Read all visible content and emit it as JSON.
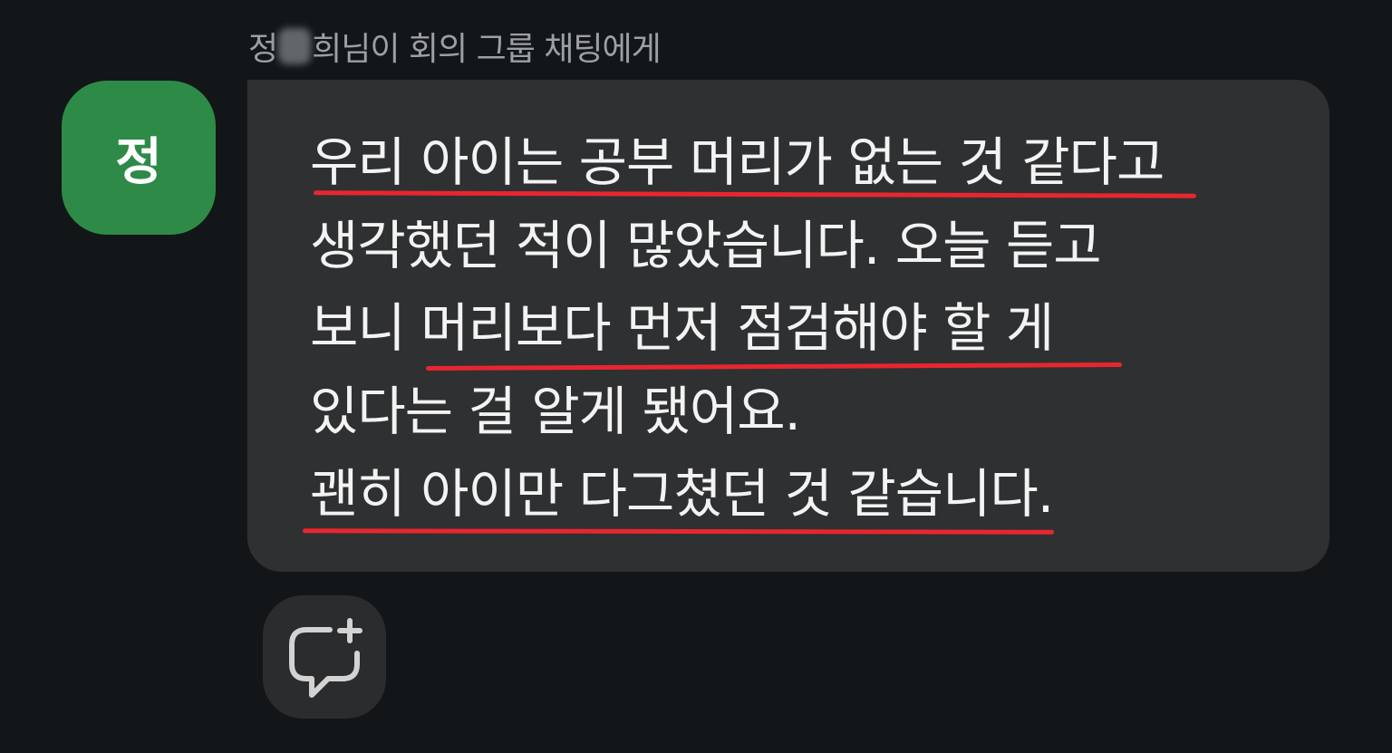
{
  "sender": {
    "prefix": "정",
    "suffix": "희님이 회의 그룹 채팅에게"
  },
  "avatar": {
    "initial": "정",
    "color": "#2e8b47"
  },
  "message": {
    "lines": [
      "우리 아이는 공부 머리가 없는 것 같다고",
      "생각했던 적이 많았습니다. 오늘 듣고",
      "보니 머리보다 먼저 점검해야 할 게",
      "있다는 걸 알게 됐어요.",
      "괜히 아이만 다그쳤던 것 같습니다."
    ],
    "highlight_color": "#e8262f"
  },
  "actions": {
    "add_reaction_icon": "chat-bubble-plus-icon"
  }
}
